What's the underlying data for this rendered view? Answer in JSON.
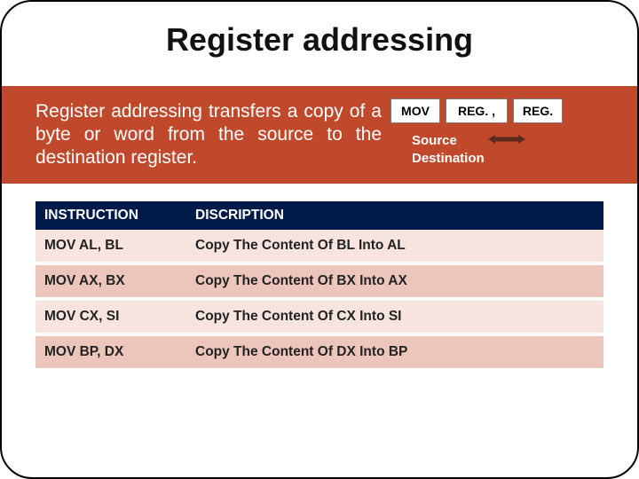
{
  "title": "Register addressing",
  "band": {
    "text": "Register addressing transfers a copy of a byte or word from the source to the destination register.",
    "diagram": {
      "mov": "MOV",
      "reg1": "REG. ,",
      "reg2": "REG.",
      "source": "Source",
      "destination": "Destination"
    }
  },
  "table": {
    "headers": {
      "col1": "INSTRUCTION",
      "col2": "DISCRIPTION"
    },
    "rows": [
      {
        "ins": "MOV AL, BL",
        "desc": "Copy The Content Of BL Into AL"
      },
      {
        "ins": "MOV AX, BX",
        "desc": "Copy The Content Of BX Into AX"
      },
      {
        "ins": "MOV CX, SI",
        "desc": "Copy The Content Of CX Into SI"
      },
      {
        "ins": "MOV BP, DX",
        "desc": "Copy The Content Of DX Into BP"
      }
    ]
  }
}
